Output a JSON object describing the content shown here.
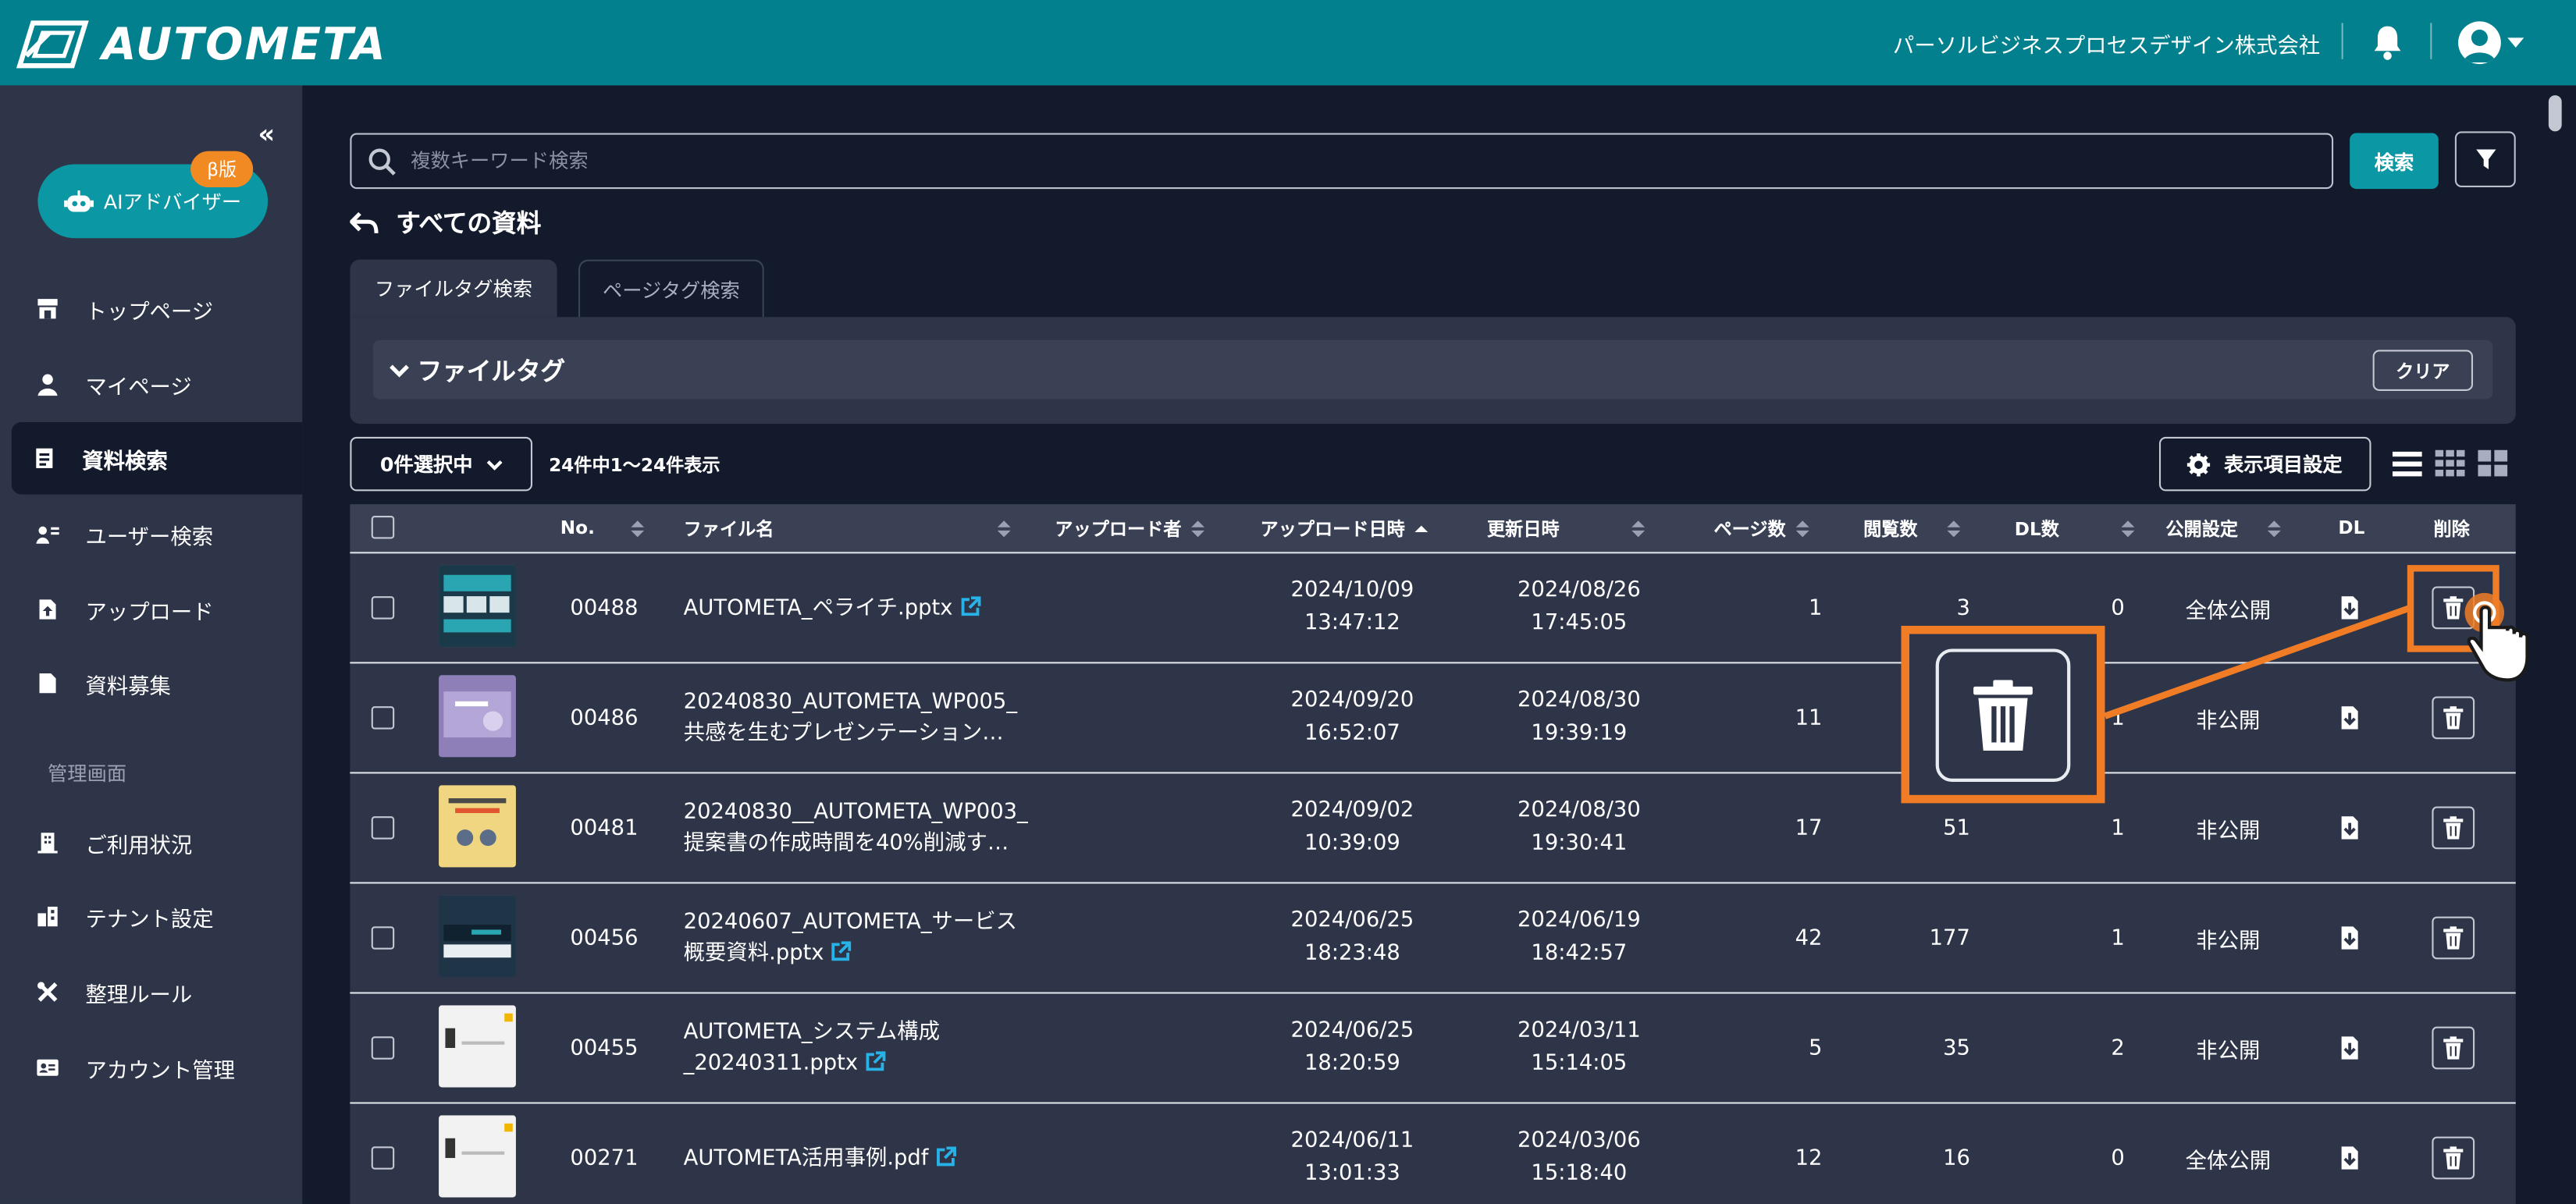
{
  "header": {
    "app_name": "AUTOMETA",
    "company": "パーソルビジネスプロセスデザイン株式会社"
  },
  "sidebar": {
    "ai_advisor_label": "AIアドバイザー",
    "beta_badge": "β版",
    "items": [
      {
        "label": "トップページ",
        "icon": "store-icon"
      },
      {
        "label": "マイページ",
        "icon": "user-icon"
      },
      {
        "label": "資料検索",
        "icon": "document-search-icon",
        "active": true
      },
      {
        "label": "ユーザー検索",
        "icon": "user-search-icon"
      },
      {
        "label": "アップロード",
        "icon": "upload-file-icon"
      },
      {
        "label": "資料募集",
        "icon": "file-icon"
      }
    ],
    "admin_section_label": "管理画面",
    "admin_items": [
      {
        "label": "ご利用状況",
        "icon": "building-icon"
      },
      {
        "label": "テナント設定",
        "icon": "tenant-icon"
      },
      {
        "label": "整理ルール",
        "icon": "tools-icon"
      },
      {
        "label": "アカウント管理",
        "icon": "id-card-icon"
      }
    ]
  },
  "search": {
    "placeholder": "複数キーワード検索",
    "button_label": "検索"
  },
  "page_title": "すべての資料",
  "tabs": [
    {
      "label": "ファイルタグ検索",
      "active": true
    },
    {
      "label": "ページタグ検索",
      "active": false
    }
  ],
  "tag_panel": {
    "title": "ファイルタグ",
    "clear_label": "クリア"
  },
  "toolbar": {
    "selected_label": "0件選択中",
    "count_text": "24件中1～24件表示",
    "column_settings_label": "表示項目設定"
  },
  "table": {
    "headers": {
      "no": "No.",
      "file_name": "ファイル名",
      "uploader": "アップロード者",
      "uploaded_at": "アップロード日時",
      "updated_at": "更新日時",
      "pages": "ページ数",
      "views": "閲覧数",
      "dl_count": "DL数",
      "visibility": "公開設定",
      "dl": "DL",
      "delete": "削除"
    },
    "rows": [
      {
        "no": "00488",
        "name1": "AUTOMETA_ペライチ.pptx",
        "name2": "",
        "up_date": "2024/10/09",
        "up_time": "13:47:12",
        "upd_date": "2024/08/26",
        "upd_time": "17:45:05",
        "pages": "1",
        "views": "3",
        "dl": "0",
        "visibility": "全体公開",
        "thumb": "teal"
      },
      {
        "no": "00486",
        "name1": "20240830_AUTOMETA_WP005_",
        "name2": "共感を生むプレゼンテーション…",
        "up_date": "2024/09/20",
        "up_time": "16:52:07",
        "upd_date": "2024/08/30",
        "upd_time": "19:39:19",
        "pages": "11",
        "views": "",
        "dl": "1",
        "visibility": "非公開",
        "thumb": "lavender"
      },
      {
        "no": "00481",
        "name1": "20240830__AUTOMETA_WP003_",
        "name2": "提案書の作成時間を40%削減す…",
        "up_date": "2024/09/02",
        "up_time": "10:39:09",
        "upd_date": "2024/08/30",
        "upd_time": "19:30:41",
        "pages": "17",
        "views": "51",
        "dl": "1",
        "visibility": "非公開",
        "thumb": "yellow"
      },
      {
        "no": "00456",
        "name1": "20240607_AUTOMETA_サービス",
        "name2": "概要資料.pptx",
        "up_date": "2024/06/25",
        "up_time": "18:23:48",
        "upd_date": "2024/06/19",
        "upd_time": "18:42:57",
        "pages": "42",
        "views": "177",
        "dl": "1",
        "visibility": "非公開",
        "thumb": "dark"
      },
      {
        "no": "00455",
        "name1": "AUTOMETA_システム構成",
        "name2": "_20240311.pptx",
        "up_date": "2024/06/25",
        "up_time": "18:20:59",
        "upd_date": "2024/03/11",
        "upd_time": "15:14:05",
        "pages": "5",
        "views": "35",
        "dl": "2",
        "visibility": "非公開",
        "thumb": "white"
      },
      {
        "no": "00271",
        "name1": "AUTOMETA活用事例.pdf",
        "name2": "",
        "up_date": "2024/06/11",
        "up_time": "13:01:33",
        "upd_date": "2024/03/06",
        "upd_time": "15:18:40",
        "pages": "12",
        "views": "16",
        "dl": "0",
        "visibility": "全体公開",
        "thumb": "white"
      }
    ]
  },
  "colors": {
    "header_bg": "#03808d",
    "accent": "#0b97a3",
    "sidebar_bg": "#2e3548",
    "page_bg": "#131a2c",
    "highlight": "#f07d26",
    "beta_badge": "#f28a24"
  }
}
